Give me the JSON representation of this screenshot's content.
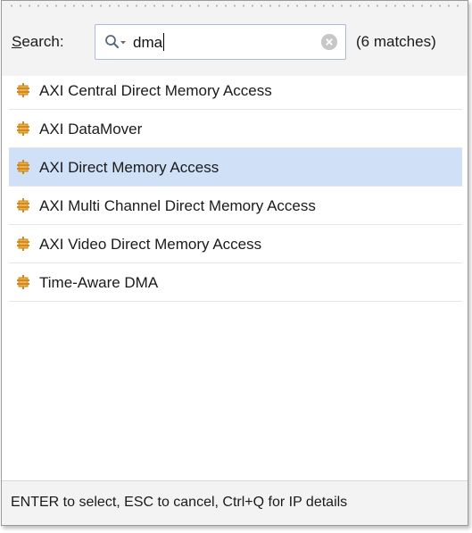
{
  "search": {
    "label_mnemonic": "S",
    "label_rest": "earch:",
    "query": "dma",
    "matches": "(6 matches)",
    "search_icon": "magnifier-dropdown-icon",
    "clear_icon": "clear-circle-icon"
  },
  "results": {
    "item_icon": "ip-block-icon",
    "items": [
      {
        "label": "AXI Central Direct Memory Access",
        "selected": false
      },
      {
        "label": "AXI DataMover",
        "selected": false
      },
      {
        "label": "AXI Direct Memory Access",
        "selected": true
      },
      {
        "label": "AXI Multi Channel Direct Memory Access",
        "selected": false
      },
      {
        "label": "AXI Video Direct Memory Access",
        "selected": false
      },
      {
        "label": "Time-Aware DMA",
        "selected": false
      }
    ]
  },
  "footer": {
    "hint": "ENTER to select, ESC to cancel, Ctrl+Q for IP details"
  },
  "colors": {
    "selected_row": "#cfe0f7",
    "ip_icon_orange": "#e8a33c",
    "search_border": "#a9bcd3"
  }
}
